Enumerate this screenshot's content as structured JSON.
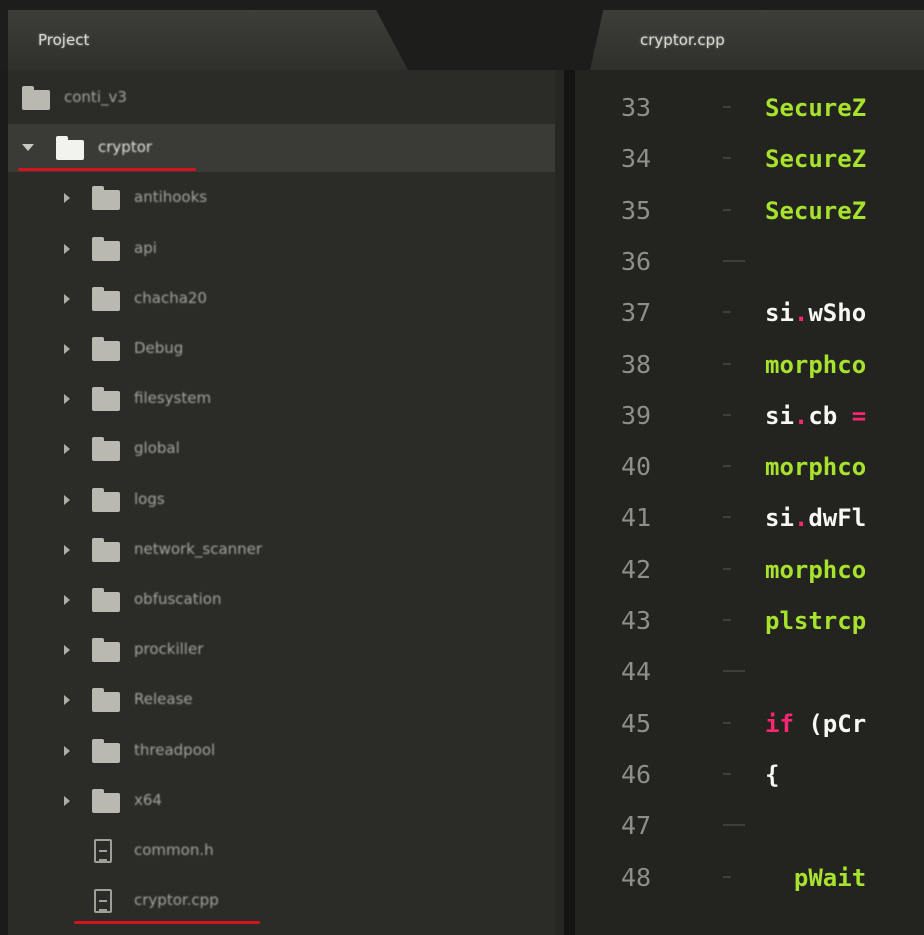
{
  "tabs": {
    "project_label": "Project",
    "file_label": "cryptor.cpp"
  },
  "sidebar": {
    "items": [
      {
        "label": "conti_v3",
        "kind": "folder",
        "depth": 0,
        "expanded": false,
        "arrow": "none",
        "selected": false,
        "underlined": false
      },
      {
        "label": "cryptor",
        "kind": "folder",
        "depth": 0,
        "expanded": true,
        "arrow": "down",
        "selected": true,
        "underlined": true
      },
      {
        "label": "antihooks",
        "kind": "folder",
        "depth": 1,
        "arrow": "right"
      },
      {
        "label": "api",
        "kind": "folder",
        "depth": 1,
        "arrow": "right"
      },
      {
        "label": "chacha20",
        "kind": "folder",
        "depth": 1,
        "arrow": "right"
      },
      {
        "label": "Debug",
        "kind": "folder",
        "depth": 1,
        "arrow": "right"
      },
      {
        "label": "filesystem",
        "kind": "folder",
        "depth": 1,
        "arrow": "right"
      },
      {
        "label": "global",
        "kind": "folder",
        "depth": 1,
        "arrow": "right"
      },
      {
        "label": "logs",
        "kind": "folder",
        "depth": 1,
        "arrow": "right"
      },
      {
        "label": "network_scanner",
        "kind": "folder",
        "depth": 1,
        "arrow": "right"
      },
      {
        "label": "obfuscation",
        "kind": "folder",
        "depth": 1,
        "arrow": "right"
      },
      {
        "label": "prockiller",
        "kind": "folder",
        "depth": 1,
        "arrow": "right"
      },
      {
        "label": "Release",
        "kind": "folder",
        "depth": 1,
        "arrow": "right"
      },
      {
        "label": "threadpool",
        "kind": "folder",
        "depth": 1,
        "arrow": "right"
      },
      {
        "label": "x64",
        "kind": "folder",
        "depth": 1,
        "arrow": "right"
      },
      {
        "label": "common.h",
        "kind": "file",
        "depth": 1,
        "arrow": "none"
      },
      {
        "label": "cryptor.cpp",
        "kind": "file",
        "depth": 1,
        "arrow": "none",
        "underlined": true
      }
    ]
  },
  "editor": {
    "lines": [
      {
        "num": "33",
        "tokens": [
          {
            "t": "SecureZ",
            "c": "#a6e22e"
          }
        ]
      },
      {
        "num": "34",
        "tokens": [
          {
            "t": "SecureZ",
            "c": "#a6e22e"
          }
        ]
      },
      {
        "num": "35",
        "tokens": [
          {
            "t": "SecureZ",
            "c": "#a6e22e"
          }
        ]
      },
      {
        "num": "36",
        "tokens": [],
        "fold": "wide"
      },
      {
        "num": "37",
        "tokens": [
          {
            "t": "si",
            "c": "#f8f8f2"
          },
          {
            "t": ".",
            "c": "#f92672"
          },
          {
            "t": "wSho",
            "c": "#f8f8f2"
          }
        ]
      },
      {
        "num": "38",
        "tokens": [
          {
            "t": "morphco",
            "c": "#a6e22e"
          }
        ]
      },
      {
        "num": "39",
        "tokens": [
          {
            "t": "si",
            "c": "#f8f8f2"
          },
          {
            "t": ".",
            "c": "#f92672"
          },
          {
            "t": "cb ",
            "c": "#f8f8f2"
          },
          {
            "t": "=",
            "c": "#f92672"
          }
        ]
      },
      {
        "num": "40",
        "tokens": [
          {
            "t": "morphco",
            "c": "#a6e22e"
          }
        ]
      },
      {
        "num": "41",
        "tokens": [
          {
            "t": "si",
            "c": "#f8f8f2"
          },
          {
            "t": ".",
            "c": "#f92672"
          },
          {
            "t": "dwFl",
            "c": "#f8f8f2"
          }
        ]
      },
      {
        "num": "42",
        "tokens": [
          {
            "t": "morphco",
            "c": "#a6e22e"
          }
        ]
      },
      {
        "num": "43",
        "tokens": [
          {
            "t": "plstrcp",
            "c": "#a6e22e"
          }
        ]
      },
      {
        "num": "44",
        "tokens": [],
        "fold": "wide"
      },
      {
        "num": "45",
        "tokens": [
          {
            "t": "if",
            "c": "#f92672"
          },
          {
            "t": " (pCr",
            "c": "#f8f8f2"
          }
        ]
      },
      {
        "num": "46",
        "tokens": [
          {
            "t": "{",
            "c": "#f8f8f2"
          }
        ]
      },
      {
        "num": "47",
        "tokens": [],
        "fold": "wide"
      },
      {
        "num": "48",
        "tokens": [
          {
            "t": "  pWait",
            "c": "#a6e22e"
          }
        ]
      }
    ]
  },
  "colors": {
    "underline": "#d4141c",
    "keyword": "#f92672",
    "function": "#a6e22e",
    "plain": "#f8f8f2"
  }
}
